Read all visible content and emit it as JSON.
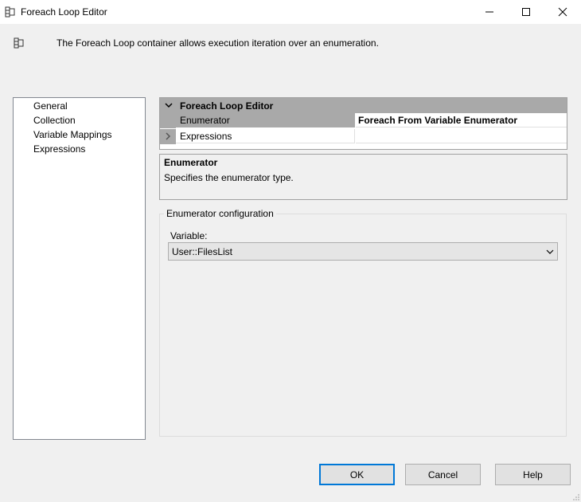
{
  "window": {
    "title": "Foreach Loop Editor"
  },
  "header": {
    "description": "The Foreach Loop container allows execution iteration over an enumeration."
  },
  "nav": {
    "items": [
      {
        "label": "General"
      },
      {
        "label": "Collection"
      },
      {
        "label": "Variable Mappings"
      },
      {
        "label": "Expressions"
      }
    ]
  },
  "property_grid": {
    "category": "Foreach Loop Editor",
    "rows": [
      {
        "name": "Enumerator",
        "value": "Foreach From Variable Enumerator"
      },
      {
        "name": "Expressions",
        "value": ""
      }
    ]
  },
  "description_panel": {
    "title": "Enumerator",
    "text": "Specifies the enumerator type."
  },
  "enumerator_config": {
    "group_label": "Enumerator configuration",
    "variable_label": "Variable:",
    "variable_value": "User::FilesList"
  },
  "buttons": {
    "ok": "OK",
    "cancel": "Cancel",
    "help": "Help"
  },
  "icons": {
    "title": "foreach-container-icon",
    "header": "foreach-container-icon",
    "minimize": "minimize-icon",
    "maximize": "maximize-icon",
    "close": "close-icon",
    "expand": "chevron-down-icon",
    "collapsed": "chevron-right-icon",
    "dropdown": "chevron-down-icon"
  }
}
